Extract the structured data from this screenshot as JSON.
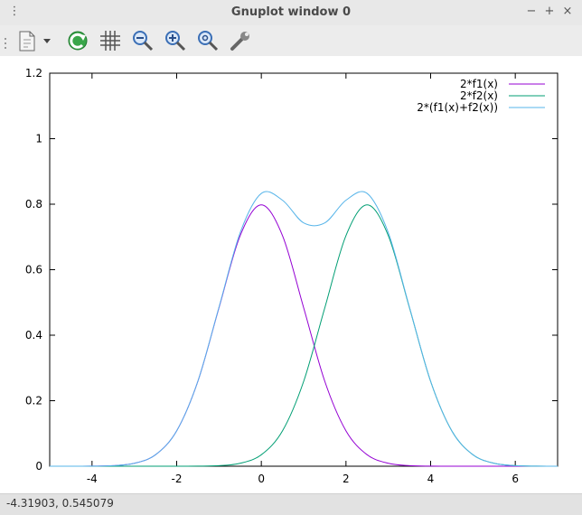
{
  "window": {
    "title": "Gnuplot window 0",
    "menu_glyph": "⋮",
    "minimize_glyph": "−",
    "maximize_glyph": "+",
    "close_glyph": "×"
  },
  "toolbar": {
    "buttons": [
      "copy-to-clipboard-icon",
      "dropdown-arrow-icon",
      "replot-icon",
      "grid-icon",
      "zoom-out-icon",
      "zoom-in-icon",
      "zoom-fit-icon",
      "settings-wrench-icon"
    ]
  },
  "status": {
    "coords": "-4.31903,  0.545079"
  },
  "chart_data": {
    "type": "line",
    "xlim": [
      -5,
      7
    ],
    "ylim": [
      0,
      1.2
    ],
    "xticks": [
      -4,
      -2,
      0,
      2,
      4,
      6
    ],
    "xtick_labels": [
      "-4",
      "-2",
      "0",
      "2",
      "4",
      "6"
    ],
    "yticks": [
      0,
      0.2,
      0.4,
      0.6,
      0.8,
      1,
      1.2
    ],
    "ytick_labels": [
      "0",
      "0.2",
      "0.4",
      "0.6",
      "0.8",
      "1",
      "1.2"
    ],
    "legend_position": "top-right",
    "grid": false,
    "series": [
      {
        "name": "2*f1(x)",
        "color": "#9400d3",
        "x": [
          -5,
          -4.5,
          -4,
          -3.5,
          -3,
          -2.5,
          -2,
          -1.5,
          -1,
          -0.5,
          0,
          0.5,
          1,
          1.5,
          2,
          2.5,
          3,
          3.5,
          4,
          4.5,
          5,
          5.5,
          6,
          6.5,
          7
        ],
        "y": [
          0.0,
          0.0001,
          0.0003,
          0.0017,
          0.0089,
          0.035,
          0.108,
          0.259,
          0.4839,
          0.7041,
          0.7979,
          0.7041,
          0.4839,
          0.259,
          0.108,
          0.035,
          0.0089,
          0.0017,
          0.0003,
          0.0,
          0.0,
          0.0,
          0.0,
          0.0,
          0.0
        ]
      },
      {
        "name": "2*f2(x)",
        "color": "#009e73",
        "x": [
          -5,
          -4.5,
          -4,
          -3.5,
          -3,
          -2.5,
          -2,
          -1.5,
          -1,
          -0.5,
          0,
          0.5,
          1,
          1.5,
          2,
          2.5,
          3,
          3.5,
          4,
          4.5,
          5,
          5.5,
          6,
          6.5,
          7
        ],
        "y": [
          0.0,
          0.0,
          0.0,
          0.0,
          0.0,
          0.0,
          0.0,
          0.0003,
          0.0017,
          0.0089,
          0.035,
          0.108,
          0.259,
          0.4839,
          0.7041,
          0.7979,
          0.7041,
          0.4839,
          0.259,
          0.108,
          0.035,
          0.0089,
          0.0017,
          0.0003,
          0.0001
        ]
      },
      {
        "name": "2*(f1(x)+f2(x))",
        "color": "#56b4e9",
        "x": [
          -5,
          -4.5,
          -4,
          -3.5,
          -3,
          -2.5,
          -2,
          -1.5,
          -1,
          -0.5,
          0,
          0.5,
          1,
          1.5,
          2,
          2.5,
          3,
          3.5,
          4,
          4.5,
          5,
          5.5,
          6,
          6.5,
          7
        ],
        "y": [
          0.0,
          0.0001,
          0.0003,
          0.0017,
          0.0089,
          0.035,
          0.108,
          0.2593,
          0.4856,
          0.713,
          0.8329,
          0.8121,
          0.7429,
          0.7429,
          0.8121,
          0.8329,
          0.713,
          0.4856,
          0.2593,
          0.108,
          0.035,
          0.0089,
          0.0017,
          0.0003,
          0.0001
        ]
      }
    ]
  }
}
